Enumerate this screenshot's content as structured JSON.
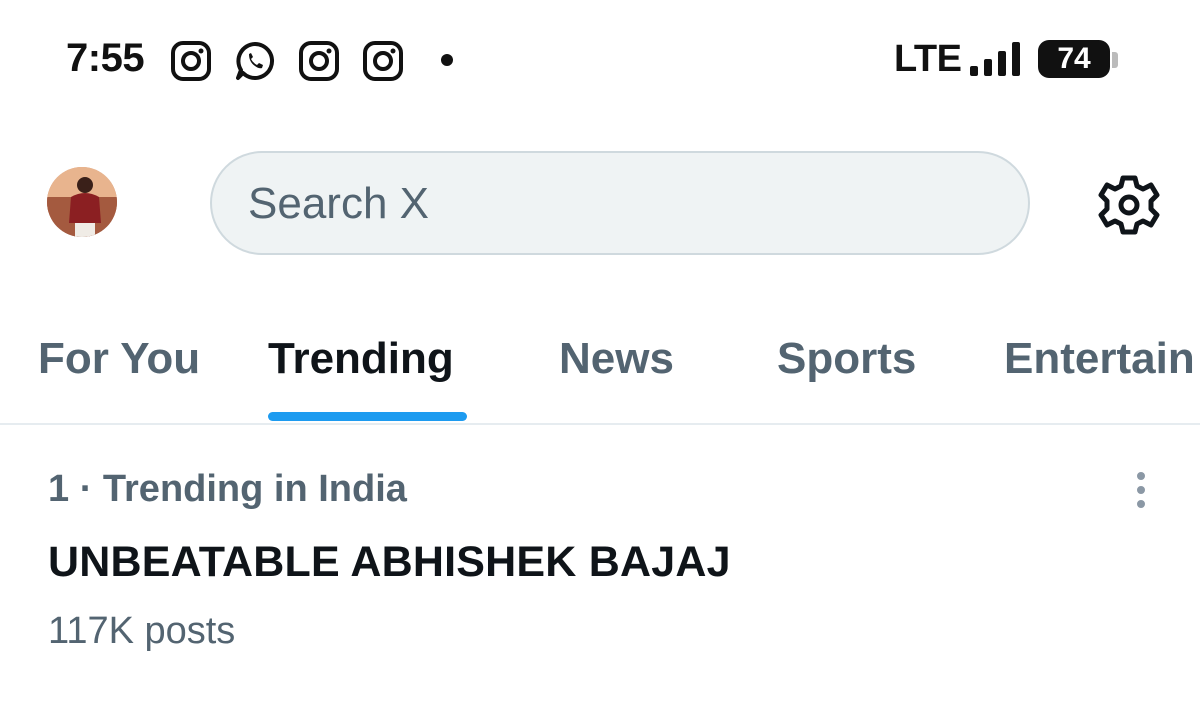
{
  "status_bar": {
    "time": "7:55",
    "notifications": [
      "instagram-icon",
      "whatsapp-icon",
      "instagram-icon",
      "instagram-icon"
    ],
    "network": "LTE",
    "battery": "74"
  },
  "header": {
    "search_placeholder": "Search X"
  },
  "tabs": [
    {
      "label": "For You",
      "active": false
    },
    {
      "label": "Trending",
      "active": true
    },
    {
      "label": "News",
      "active": false
    },
    {
      "label": "Sports",
      "active": false
    },
    {
      "label": "Entertain",
      "active": false
    }
  ],
  "trend": {
    "meta": "1 · Trending in India",
    "title": "UNBEATABLE ABHISHEK BAJAJ",
    "count": "117K posts"
  },
  "colors": {
    "accent": "#1d9bf0",
    "primary_text": "#0f1419",
    "secondary_text": "#536471",
    "search_bg": "#eff3f4"
  }
}
